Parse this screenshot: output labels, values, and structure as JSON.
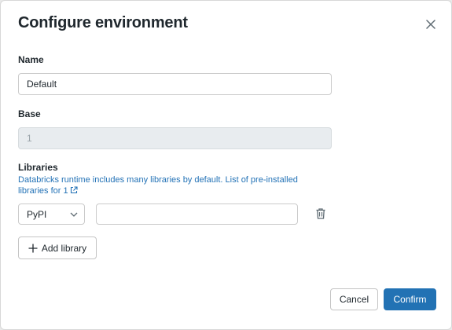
{
  "dialog": {
    "title": "Configure environment",
    "close_icon": "close-icon"
  },
  "name_field": {
    "label": "Name",
    "value": "Default"
  },
  "base_field": {
    "label": "Base",
    "value": "1",
    "disabled": true
  },
  "libraries": {
    "label": "Libraries",
    "help_text": "Databricks runtime includes many libraries by default.",
    "link_text": "List of pre-installed libraries for 1",
    "link_icon": "external-link-icon",
    "rows": [
      {
        "source": "PyPI",
        "package": "",
        "delete_icon": "trash-icon"
      }
    ],
    "add_label": "Add library",
    "add_icon": "plus-icon"
  },
  "footer": {
    "cancel_label": "Cancel",
    "confirm_label": "Confirm"
  },
  "colors": {
    "primary": "#2272b4",
    "link": "#2372b6",
    "text": "#1f272d",
    "disabled_bg": "#e8ecef"
  }
}
